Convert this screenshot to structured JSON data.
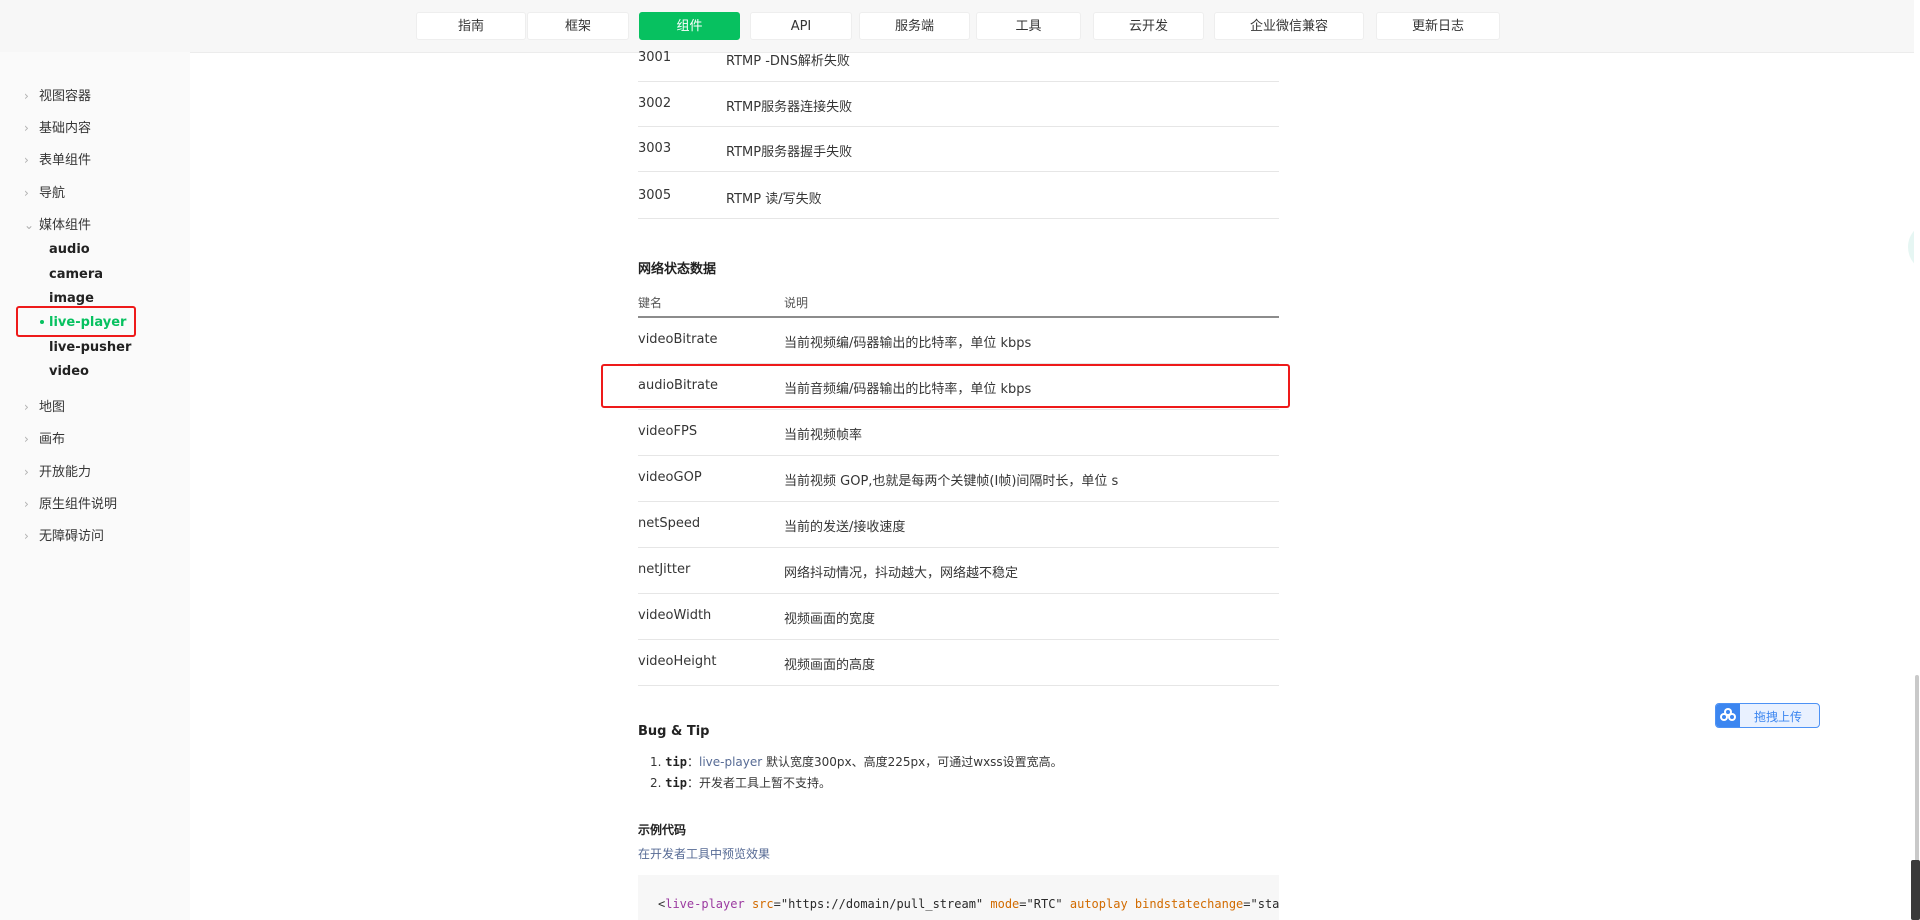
{
  "topnav": {
    "tabs": [
      {
        "label": "指南"
      },
      {
        "label": "框架"
      },
      {
        "label": "组件"
      },
      {
        "label": "API"
      },
      {
        "label": "服务端"
      },
      {
        "label": "工具"
      },
      {
        "label": "云开发"
      },
      {
        "label": "企业微信兼容"
      },
      {
        "label": "更新日志"
      }
    ],
    "active_tab": "组件"
  },
  "sidebar": {
    "items": [
      {
        "label": "视图容器"
      },
      {
        "label": "基础内容"
      },
      {
        "label": "表单组件"
      },
      {
        "label": "导航"
      },
      {
        "label": "媒体组件"
      },
      {
        "label": "地图"
      },
      {
        "label": "画布"
      },
      {
        "label": "开放能力"
      },
      {
        "label": "原生组件说明"
      },
      {
        "label": "无障碍访问"
      }
    ],
    "media_sub": [
      {
        "label": "audio"
      },
      {
        "label": "camera"
      },
      {
        "label": "image"
      },
      {
        "label": "live-player"
      },
      {
        "label": "live-pusher"
      },
      {
        "label": "video"
      }
    ],
    "active_sub": "live-player"
  },
  "error_rows": [
    {
      "code": "3001",
      "desc": "RTMP -DNS解析失败"
    },
    {
      "code": "3002",
      "desc": "RTMP服务器连接失败"
    },
    {
      "code": "3003",
      "desc": "RTMP服务器握手失败"
    },
    {
      "code": "3005",
      "desc": "RTMP 读/写失败"
    }
  ],
  "net_status": {
    "title": "网络状态数据",
    "col_key": "键名",
    "col_desc": "说明",
    "rows": [
      {
        "key": "videoBitrate",
        "desc": "当前视频编/码器输出的比特率，单位 kbps"
      },
      {
        "key": "audioBitrate",
        "desc": "当前音频编/码器输出的比特率，单位 kbps"
      },
      {
        "key": "videoFPS",
        "desc": "当前视频帧率"
      },
      {
        "key": "videoGOP",
        "desc": "当前视频 GOP,也就是每两个关键帧(I帧)间隔时长，单位 s"
      },
      {
        "key": "netSpeed",
        "desc": "当前的发送/接收速度"
      },
      {
        "key": "netJitter",
        "desc": "网络抖动情况，抖动越大，网络越不稳定"
      },
      {
        "key": "videoWidth",
        "desc": "视频画面的宽度"
      },
      {
        "key": "videoHeight",
        "desc": "视频画面的高度"
      }
    ]
  },
  "bug_tip": {
    "title": "Bug & Tip",
    "tips": [
      {
        "num": "1.",
        "code": "tip",
        "sep": "：",
        "link": "live-player",
        "text": " 默认宽度300px、高度225px，可通过wxss设置宽高。"
      },
      {
        "num": "2.",
        "code": "tip",
        "sep": "：",
        "link": "",
        "text": "开发者工具上暂不支持。"
      }
    ]
  },
  "example": {
    "title": "示例代码",
    "preview_link": "在开发者工具中预览效果",
    "code": {
      "open": "<",
      "tag": "live-player",
      "attr1": " src",
      "eq1": "=",
      "val1": "\"https://domain/pull_stream\"",
      "attr2": " mode",
      "eq2": "=",
      "val2": "\"RTC\"",
      "attr3": " autoplay",
      "attr4": " bindstatechange",
      "eq4": "=",
      "val4": "\"statechange"
    }
  },
  "upload_widget": {
    "label": "拖拽上传"
  },
  "colors": {
    "accent": "#07c160",
    "highlight_box": "#ee1a1a",
    "link": "#576b95"
  }
}
